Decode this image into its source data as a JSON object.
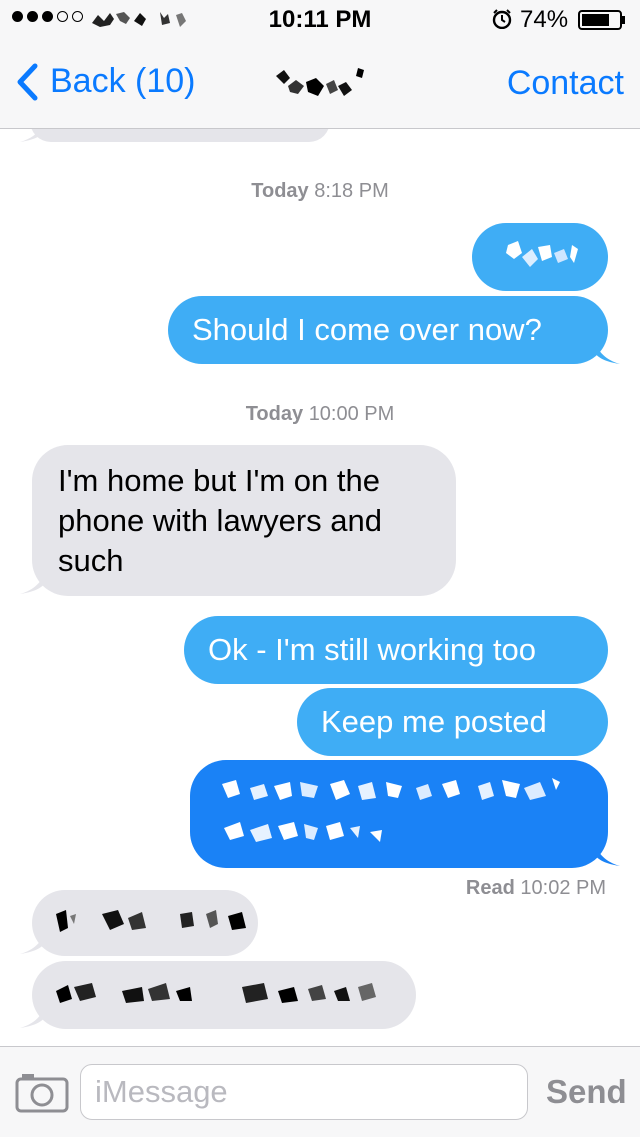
{
  "status_bar": {
    "time": "10:11 PM",
    "battery_percent": "74%",
    "battery_level": 0.74,
    "signal_bars_filled": 3,
    "signal_bars_total": 5
  },
  "nav": {
    "back_label": "Back (10)",
    "right_label": "Contact"
  },
  "messages": {
    "ts1_day": "Today",
    "ts1_time": "8:18 PM",
    "out1_text": "Should I come over now?",
    "ts2_day": "Today",
    "ts2_time": "10:00 PM",
    "in1_text": "I'm home but I'm on the phone with lawyers and such",
    "out2_text": "Ok - I'm still working too",
    "out3_text": "Keep me posted",
    "read_label": "Read",
    "read_time": "10:02 PM"
  },
  "input_bar": {
    "placeholder": "iMessage",
    "send_label": "Send"
  },
  "colors": {
    "accent": "#0a7aff",
    "sms_blue": "#3fadf5",
    "imessage_blue": "#1a82f6",
    "incoming_gray": "#e5e5ea"
  }
}
